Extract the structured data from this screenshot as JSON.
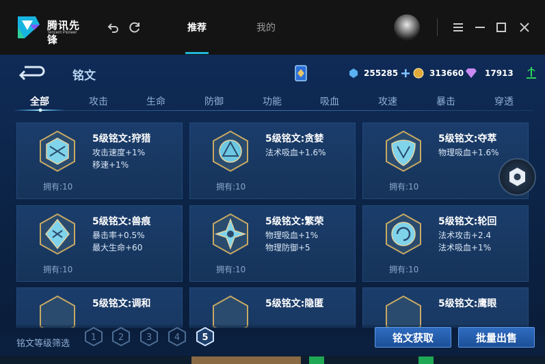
{
  "app": {
    "name": "腾讯先锋",
    "subtitle": "Tencent Pioneer",
    "tabs": [
      {
        "label": "推荐",
        "active": true
      },
      {
        "label": "我的",
        "active": false
      }
    ],
    "accent_color": "#1fb7d8"
  },
  "game": {
    "title": "铭文",
    "currencies": [
      {
        "icon": "blue-diamond-icon",
        "value": "255285"
      },
      {
        "icon": "gold-coin-icon",
        "value": "313660"
      },
      {
        "icon": "purple-gem-icon",
        "value": "17913"
      }
    ],
    "categories": [
      "全部",
      "攻击",
      "生命",
      "防御",
      "功能",
      "吸血",
      "攻速",
      "暴击",
      "穿透"
    ],
    "active_category": "全部",
    "cards": [
      {
        "name": "5级铭文:狩猎",
        "attrs": [
          "攻击速度+1%",
          "移速+1%"
        ],
        "owned": "拥有:10"
      },
      {
        "name": "5级铭文:贪婪",
        "attrs": [
          "法术吸血+1.6%",
          ""
        ],
        "owned": "拥有:10"
      },
      {
        "name": "5级铭文:夺萃",
        "attrs": [
          "物理吸血+1.6%",
          ""
        ],
        "owned": "拥有:10"
      },
      {
        "name": "5级铭文:兽痕",
        "attrs": [
          "暴击率+0.5%",
          "最大生命+60"
        ],
        "owned": "拥有:10"
      },
      {
        "name": "5级铭文:繁荣",
        "attrs": [
          "物理吸血+1%",
          "物理防御+5"
        ],
        "owned": "拥有:10"
      },
      {
        "name": "5级铭文:轮回",
        "attrs": [
          "法术攻击+2.4",
          "法术吸血+1%"
        ],
        "owned": "拥有:10"
      },
      {
        "name": "5级铭文:调和",
        "attrs": [
          "",
          ""
        ],
        "owned": ""
      },
      {
        "name": "5级铭文:隐匿",
        "attrs": [
          "",
          ""
        ],
        "owned": ""
      },
      {
        "name": "5级铭文:鹰眼",
        "attrs": [
          "",
          ""
        ],
        "owned": ""
      }
    ],
    "filter_label": "铭文等级筛选",
    "levels": [
      "1",
      "2",
      "3",
      "4",
      "5"
    ],
    "active_level": "5",
    "buttons": {
      "acquire": "铭文获取",
      "bulk_sell": "批量出售"
    }
  }
}
